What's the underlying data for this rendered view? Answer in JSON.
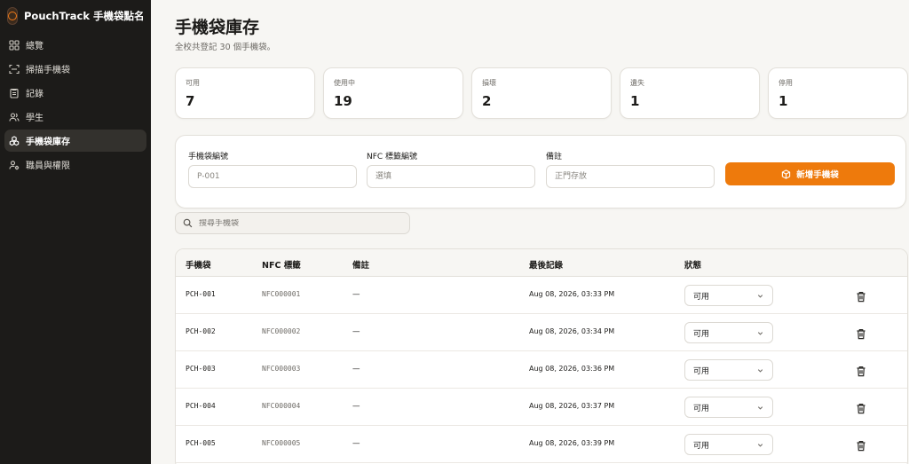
{
  "app": {
    "name": "PouchTrack 手機袋點名"
  },
  "sidebar": {
    "items": [
      {
        "label": "總覽",
        "icon": "grid-icon",
        "active": false
      },
      {
        "label": "掃描手機袋",
        "icon": "scan-icon",
        "active": false
      },
      {
        "label": "記錄",
        "icon": "clipboard-icon",
        "active": false
      },
      {
        "label": "學生",
        "icon": "users-icon",
        "active": false
      },
      {
        "label": "手機袋庫存",
        "icon": "boxes-icon",
        "active": true
      },
      {
        "label": "職員與權限",
        "icon": "user-cog-icon",
        "active": false
      }
    ]
  },
  "page": {
    "title": "手機袋庫存",
    "subtitle": "全校共登記 30 個手機袋。"
  },
  "stats": [
    {
      "label": "可用",
      "value": "7"
    },
    {
      "label": "使用中",
      "value": "19"
    },
    {
      "label": "損壞",
      "value": "2"
    },
    {
      "label": "遺失",
      "value": "1"
    },
    {
      "label": "停用",
      "value": "1"
    }
  ],
  "form": {
    "pouch_label": "手機袋編號",
    "pouch_placeholder": "P-001",
    "nfc_label": "NFC 標籤編號",
    "nfc_placeholder": "選填",
    "note_label": "備註",
    "note_placeholder": "正門存放",
    "add_button": "新增手機袋"
  },
  "search": {
    "placeholder": "搜尋手機袋"
  },
  "table": {
    "headers": {
      "pouch": "手機袋",
      "nfc": "NFC 標籤",
      "note": "備註",
      "last": "最後記錄",
      "status": "狀態"
    },
    "rows": [
      {
        "pouch": "PCH-001",
        "nfc": "NFC000001",
        "note": "—",
        "last": "Aug 08, 2026, 03:33 PM",
        "status": "可用"
      },
      {
        "pouch": "PCH-002",
        "nfc": "NFC000002",
        "note": "—",
        "last": "Aug 08, 2026, 03:34 PM",
        "status": "可用"
      },
      {
        "pouch": "PCH-003",
        "nfc": "NFC000003",
        "note": "—",
        "last": "Aug 08, 2026, 03:36 PM",
        "status": "可用"
      },
      {
        "pouch": "PCH-004",
        "nfc": "NFC000004",
        "note": "—",
        "last": "Aug 08, 2026, 03:37 PM",
        "status": "可用"
      },
      {
        "pouch": "PCH-005",
        "nfc": "NFC000005",
        "note": "—",
        "last": "Aug 08, 2026, 03:39 PM",
        "status": "可用"
      }
    ]
  },
  "colors": {
    "accent": "#ee7a0c",
    "sidebar_bg": "#1c1b19",
    "page_bg": "#f7f6f3"
  }
}
